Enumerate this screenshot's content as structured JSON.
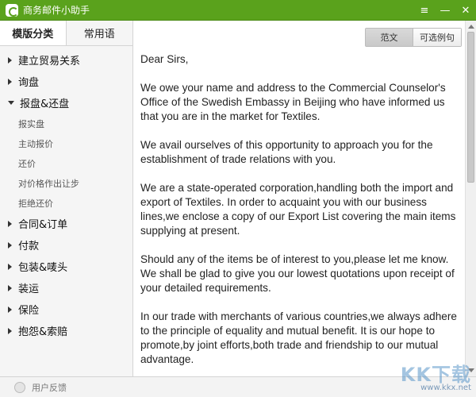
{
  "window": {
    "title": "商务邮件小助手",
    "controls": [
      "≡",
      "—",
      "✕"
    ]
  },
  "sidebar": {
    "tabs": [
      {
        "label": "模版分类",
        "active": true
      },
      {
        "label": "常用语",
        "active": false
      }
    ],
    "items": [
      {
        "label": "建立贸易关系",
        "expanded": false
      },
      {
        "label": "询盘",
        "expanded": false
      },
      {
        "label": "报盘&还盘",
        "expanded": true,
        "children": [
          "报实盘",
          "主动报价",
          "还价",
          "对价格作出让步",
          "拒绝还价"
        ]
      },
      {
        "label": "合同&订单",
        "expanded": false
      },
      {
        "label": "付款",
        "expanded": false
      },
      {
        "label": "包装&唛头",
        "expanded": false
      },
      {
        "label": "装运",
        "expanded": false
      },
      {
        "label": "保险",
        "expanded": false
      },
      {
        "label": "抱怨&索赔",
        "expanded": false
      }
    ]
  },
  "content": {
    "toggle": [
      {
        "label": "范文",
        "selected": true
      },
      {
        "label": "可选例句",
        "selected": false
      }
    ],
    "paragraphs": [
      "Dear Sirs,",
      "We owe  your name and address to the Commercial  Counselor's Office of the Swedish Embassy in Beijing who have informed us that you are in the market for Textiles.",
      "We avail ourselves of this opportunity to approach  you for the establishment of trade relations with you.",
      "We are a state-operated corporation,handling both the import and export of Textiles. In order to acquaint you with our business lines,we enclose a copy of our Export List covering the main items supplying at present.",
      "Should any of the items be of interest to you,please let me know. We shall be glad to give you our lowest quotations upon receipt of your detailed requirements.",
      "In our trade with merchants of various countries,we always adhere to the principle of equality and mutual benefit. It is our hope to promote,by joint efforts,both trade and friendship to our mutual advantage."
    ]
  },
  "footer": {
    "feedback_label": "用户反馈"
  },
  "watermark": {
    "logo_text": "KK下载",
    "url": "www.kkx.net"
  },
  "colors": {
    "titlebar": "#5aa21c",
    "sidebar_bg": "#f5f5f5"
  }
}
